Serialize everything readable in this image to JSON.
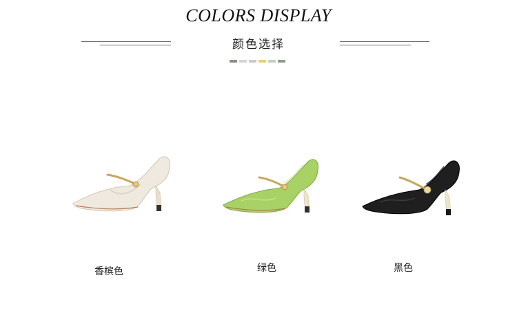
{
  "header": {
    "title": "COLORS DISPLAY",
    "subtitle": "颜色选择"
  },
  "swatches": [
    "#8a8f8a",
    "#d9d3cb",
    "#c9c9c9",
    "#e6cf7a",
    "#c7cfc2",
    "#8f9990"
  ],
  "products": [
    {
      "label": "香槟色",
      "color_name": "champagne"
    },
    {
      "label": "绿色",
      "color_name": "green"
    },
    {
      "label": "黑色",
      "color_name": "black"
    }
  ]
}
